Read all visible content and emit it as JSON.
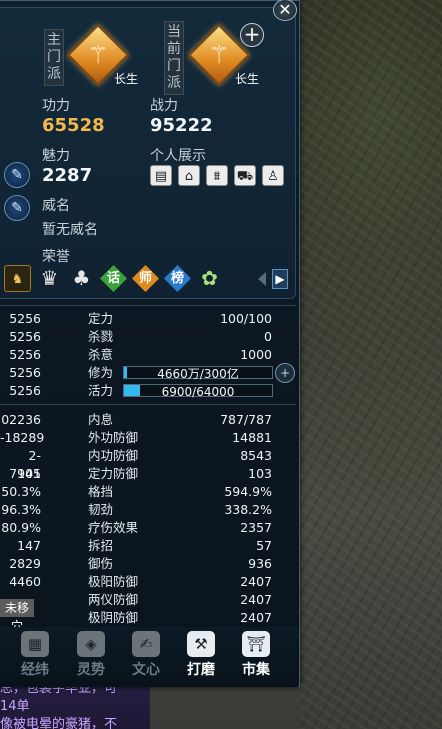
{
  "chat": {
    "lines": [
      "总，包装字华亚，可",
      "14单",
      "像被电晕的豪猪，不"
    ]
  },
  "header": {
    "main_school_label": "主门派",
    "main_school_name": "长生",
    "current_school_label": "当前门派",
    "current_school_name": "长生"
  },
  "stats": {
    "gongli_label": "功力",
    "gongli_value": "65528",
    "zhanli_label": "战力",
    "zhanli_value": "95222",
    "meili_label": "魅力",
    "meili_value": "2287",
    "personal_show_label": "个人展示",
    "weiming_label": "威名",
    "weiming_value": "暂无威名",
    "rongyu_label": "荣誉"
  },
  "show_icons": [
    "名片",
    "家园",
    "宫殿",
    "车",
    "衣"
  ],
  "honor_icons": [
    "铠",
    "冠",
    "桃",
    "话",
    "师",
    "榜",
    "莲"
  ],
  "group1": [
    {
      "left": "5256",
      "name": "定力",
      "right": "100/100"
    },
    {
      "left": "5256",
      "name": "杀戮",
      "right": "0"
    },
    {
      "left": "5256",
      "name": "杀意",
      "right": "1000"
    },
    {
      "left": "5256",
      "name": "修为",
      "bar_text": "4660万/300亿",
      "fill": 0.02
    },
    {
      "left": "5256",
      "name": "活力",
      "bar_text": "6900/64000",
      "fill": 0.11
    }
  ],
  "group2": [
    {
      "left": "02236",
      "name": "内息",
      "right": "787/787"
    },
    {
      "left": "-18289",
      "name": "外功防御",
      "right": "14881"
    },
    {
      "left": "2-7941",
      "name": "内功防御",
      "right": "8543"
    },
    {
      "left": "105",
      "name": "定力防御",
      "right": "103"
    },
    {
      "left": "50.3%",
      "name": "格挡",
      "right": "594.9%"
    },
    {
      "left": "96.3%",
      "name": "韧劲",
      "right": "338.2%"
    },
    {
      "left": "80.9%",
      "name": "疗伤效果",
      "right": "2357"
    },
    {
      "left": "147",
      "name": "拆招",
      "right": "57"
    },
    {
      "left": "2829",
      "name": "御伤",
      "right": "936"
    },
    {
      "left": "4460",
      "name": "极阳防御",
      "right": "2407"
    },
    {
      "left": "",
      "name": "两仪防御",
      "right": "2407"
    },
    {
      "left": "",
      "name": "极阴防御",
      "right": "2407"
    }
  ],
  "unmove_label": "未移穴",
  "bottom_nav": [
    {
      "label": "经纬",
      "icon": "grid",
      "active": false
    },
    {
      "label": "灵势",
      "icon": "spirit",
      "active": false
    },
    {
      "label": "文心",
      "icon": "brush",
      "active": false
    },
    {
      "label": "打磨",
      "icon": "hammer",
      "active": true
    },
    {
      "label": "市集",
      "icon": "market",
      "active": true
    }
  ]
}
